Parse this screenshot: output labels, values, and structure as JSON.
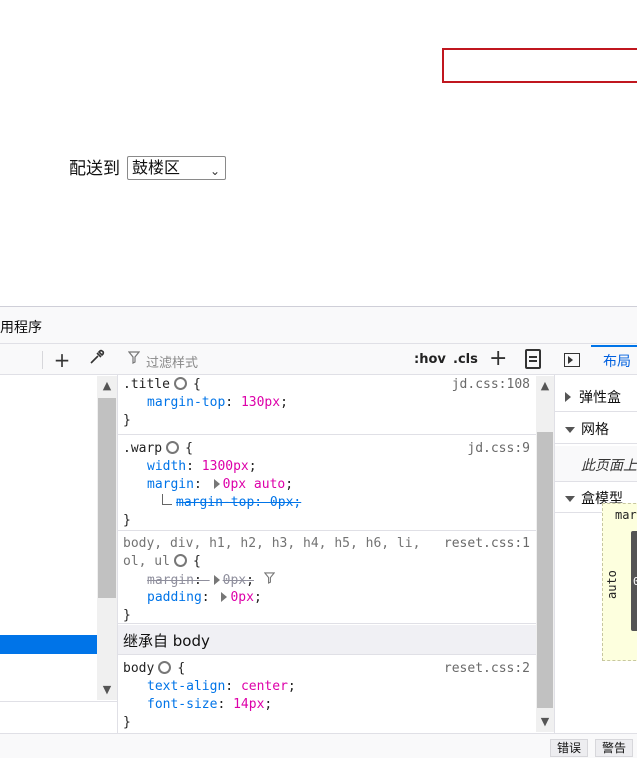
{
  "page": {
    "deliver_label": "配送到",
    "district_selected": "鼓楼区"
  },
  "devtools": {
    "tab_title": "用程序",
    "rules_toolbar": {
      "filter_placeholder": "过滤样式",
      "hov_label": ":hov",
      "cls_label": ".cls",
      "add_label": "+"
    },
    "rules": {
      "title_rule": {
        "selector": ".title",
        "source": "jd.css:108",
        "decls": [
          {
            "name": "margin-top",
            "value": "130px"
          }
        ]
      },
      "warp_rule": {
        "selector": ".warp",
        "source": "jd.css:9",
        "width_name": "width",
        "width_value": "1300px",
        "margin_name": "margin",
        "margin_value": "0px auto",
        "sub_margin_top": "margin-top: 0px;"
      },
      "reset_rule": {
        "selector_line1": "body, div, h1, h2, h3, h4, h5, h6, li,",
        "selector_line2": "ol, ul",
        "source": "reset.css:1",
        "margin_name": "margin",
        "margin_value": "0px",
        "padding_name": "padding",
        "padding_value": "0px"
      },
      "inherited_header": "继承自 body",
      "body_rule": {
        "selector": "body",
        "source": "reset.css:2",
        "align_name": "text-align",
        "align_value": "center",
        "size_name": "font-size",
        "size_value": "14px"
      },
      "open_brace": "{",
      "close_brace": "}"
    },
    "layout": {
      "tab_label": "布局",
      "flexbox_label": "弹性盒",
      "grid_label": "网格",
      "grid_note": "此页面上",
      "boxmodel_label": "盒模型",
      "margin_label": "mar",
      "margin_side_value": "auto",
      "border_value": "0"
    },
    "status": {
      "errors_label": "错误",
      "warnings_label": "警告"
    }
  }
}
